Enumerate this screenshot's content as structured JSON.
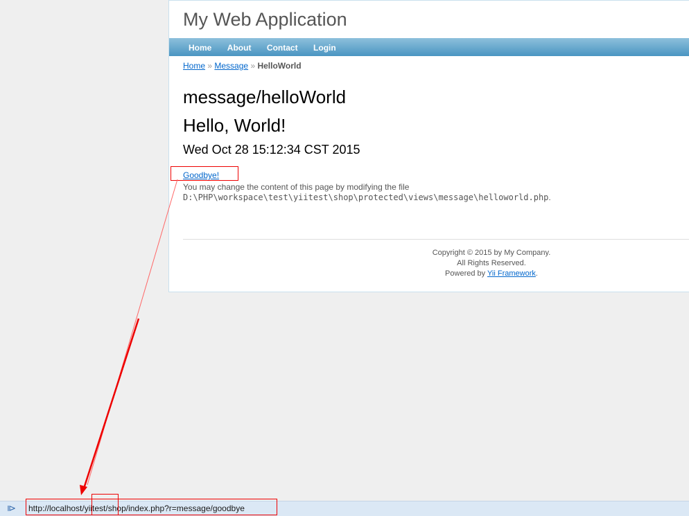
{
  "app": {
    "title": "My Web Application",
    "menu": [
      "Home",
      "About",
      "Contact",
      "Login"
    ]
  },
  "breadcrumb": {
    "home": "Home",
    "message": "Message",
    "sep": "»",
    "current": "HelloWorld"
  },
  "content": {
    "route": "message/helloWorld",
    "greeting": "Hello, World!",
    "time": "Wed Oct 28 15:12:34 CST 2015",
    "goodbye_link": "Goodbye!",
    "note": "You may change the content of this page by modifying the file",
    "path": "D:\\PHP\\workspace\\test\\yiitest\\shop\\protected\\views\\message\\helloworld.php",
    "period": "."
  },
  "footer": {
    "copyright": "Copyright © 2015 by My Company.",
    "rights": "All Rights Reserved.",
    "powered": "Powered by ",
    "framework": "Yii Framework",
    "period": "."
  },
  "statusbar": {
    "url": "http://localhost/yiitest/shop/index.php?r=message/goodbye"
  }
}
